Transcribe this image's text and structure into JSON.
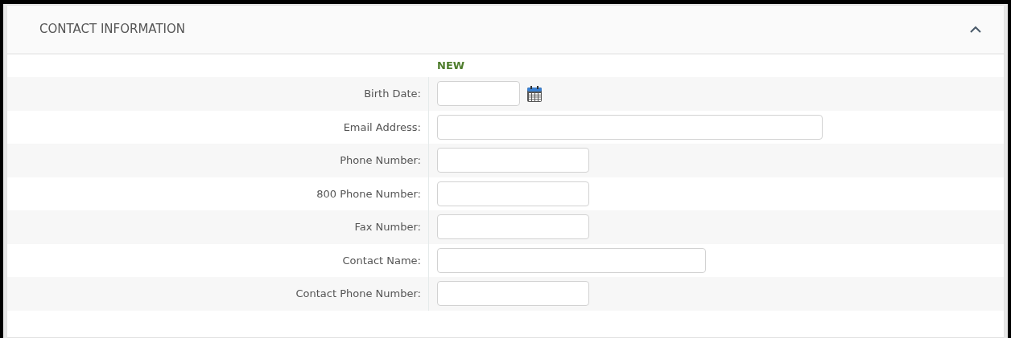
{
  "panel": {
    "title": "CONTACT INFORMATION",
    "expanded": true
  },
  "column_header": "NEW",
  "fields": [
    {
      "label": "Birth Date:",
      "kind": "date"
    },
    {
      "label": "Email Address:",
      "kind": "wide"
    },
    {
      "label": "Phone Number:",
      "kind": "short"
    },
    {
      "label": "800 Phone Number:",
      "kind": "short"
    },
    {
      "label": "Fax Number:",
      "kind": "short"
    },
    {
      "label": "Contact Name:",
      "kind": "medium"
    },
    {
      "label": "Contact Phone Number:",
      "kind": "short"
    }
  ]
}
